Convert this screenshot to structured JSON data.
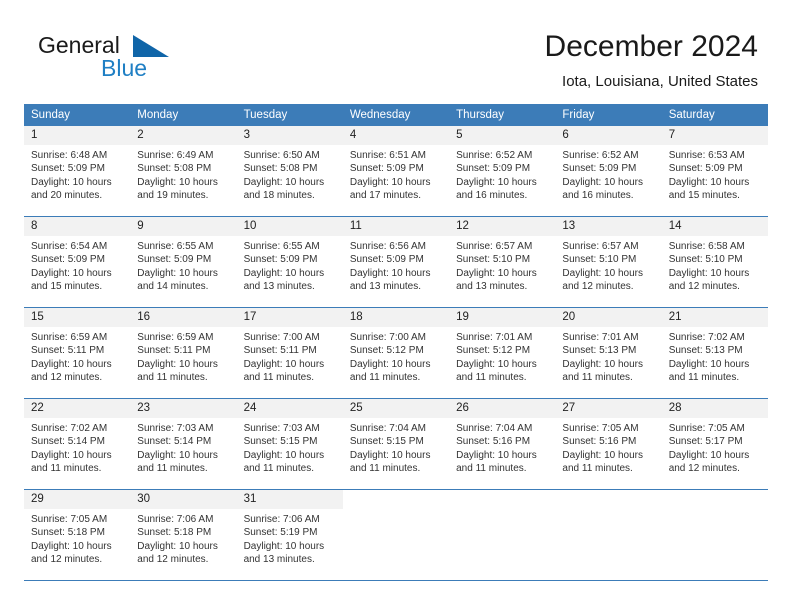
{
  "brand": {
    "name_part1": "General",
    "name_part2": "Blue",
    "triangle_color": "#1065a8",
    "blue_color": "#1f7fc4"
  },
  "header": {
    "title": "December 2024",
    "subtitle": "Iota, Louisiana, United States"
  },
  "calendar": {
    "header_bg": "#3c7cb8",
    "daynum_bg": "#f2f2f2",
    "weekdays": [
      "Sunday",
      "Monday",
      "Tuesday",
      "Wednesday",
      "Thursday",
      "Friday",
      "Saturday"
    ],
    "weeks": [
      [
        {
          "day": "1",
          "sunrise": "Sunrise: 6:48 AM",
          "sunset": "Sunset: 5:09 PM",
          "daylight1": "Daylight: 10 hours",
          "daylight2": "and 20 minutes."
        },
        {
          "day": "2",
          "sunrise": "Sunrise: 6:49 AM",
          "sunset": "Sunset: 5:08 PM",
          "daylight1": "Daylight: 10 hours",
          "daylight2": "and 19 minutes."
        },
        {
          "day": "3",
          "sunrise": "Sunrise: 6:50 AM",
          "sunset": "Sunset: 5:08 PM",
          "daylight1": "Daylight: 10 hours",
          "daylight2": "and 18 minutes."
        },
        {
          "day": "4",
          "sunrise": "Sunrise: 6:51 AM",
          "sunset": "Sunset: 5:09 PM",
          "daylight1": "Daylight: 10 hours",
          "daylight2": "and 17 minutes."
        },
        {
          "day": "5",
          "sunrise": "Sunrise: 6:52 AM",
          "sunset": "Sunset: 5:09 PM",
          "daylight1": "Daylight: 10 hours",
          "daylight2": "and 16 minutes."
        },
        {
          "day": "6",
          "sunrise": "Sunrise: 6:52 AM",
          "sunset": "Sunset: 5:09 PM",
          "daylight1": "Daylight: 10 hours",
          "daylight2": "and 16 minutes."
        },
        {
          "day": "7",
          "sunrise": "Sunrise: 6:53 AM",
          "sunset": "Sunset: 5:09 PM",
          "daylight1": "Daylight: 10 hours",
          "daylight2": "and 15 minutes."
        }
      ],
      [
        {
          "day": "8",
          "sunrise": "Sunrise: 6:54 AM",
          "sunset": "Sunset: 5:09 PM",
          "daylight1": "Daylight: 10 hours",
          "daylight2": "and 15 minutes."
        },
        {
          "day": "9",
          "sunrise": "Sunrise: 6:55 AM",
          "sunset": "Sunset: 5:09 PM",
          "daylight1": "Daylight: 10 hours",
          "daylight2": "and 14 minutes."
        },
        {
          "day": "10",
          "sunrise": "Sunrise: 6:55 AM",
          "sunset": "Sunset: 5:09 PM",
          "daylight1": "Daylight: 10 hours",
          "daylight2": "and 13 minutes."
        },
        {
          "day": "11",
          "sunrise": "Sunrise: 6:56 AM",
          "sunset": "Sunset: 5:09 PM",
          "daylight1": "Daylight: 10 hours",
          "daylight2": "and 13 minutes."
        },
        {
          "day": "12",
          "sunrise": "Sunrise: 6:57 AM",
          "sunset": "Sunset: 5:10 PM",
          "daylight1": "Daylight: 10 hours",
          "daylight2": "and 13 minutes."
        },
        {
          "day": "13",
          "sunrise": "Sunrise: 6:57 AM",
          "sunset": "Sunset: 5:10 PM",
          "daylight1": "Daylight: 10 hours",
          "daylight2": "and 12 minutes."
        },
        {
          "day": "14",
          "sunrise": "Sunrise: 6:58 AM",
          "sunset": "Sunset: 5:10 PM",
          "daylight1": "Daylight: 10 hours",
          "daylight2": "and 12 minutes."
        }
      ],
      [
        {
          "day": "15",
          "sunrise": "Sunrise: 6:59 AM",
          "sunset": "Sunset: 5:11 PM",
          "daylight1": "Daylight: 10 hours",
          "daylight2": "and 12 minutes."
        },
        {
          "day": "16",
          "sunrise": "Sunrise: 6:59 AM",
          "sunset": "Sunset: 5:11 PM",
          "daylight1": "Daylight: 10 hours",
          "daylight2": "and 11 minutes."
        },
        {
          "day": "17",
          "sunrise": "Sunrise: 7:00 AM",
          "sunset": "Sunset: 5:11 PM",
          "daylight1": "Daylight: 10 hours",
          "daylight2": "and 11 minutes."
        },
        {
          "day": "18",
          "sunrise": "Sunrise: 7:00 AM",
          "sunset": "Sunset: 5:12 PM",
          "daylight1": "Daylight: 10 hours",
          "daylight2": "and 11 minutes."
        },
        {
          "day": "19",
          "sunrise": "Sunrise: 7:01 AM",
          "sunset": "Sunset: 5:12 PM",
          "daylight1": "Daylight: 10 hours",
          "daylight2": "and 11 minutes."
        },
        {
          "day": "20",
          "sunrise": "Sunrise: 7:01 AM",
          "sunset": "Sunset: 5:13 PM",
          "daylight1": "Daylight: 10 hours",
          "daylight2": "and 11 minutes."
        },
        {
          "day": "21",
          "sunrise": "Sunrise: 7:02 AM",
          "sunset": "Sunset: 5:13 PM",
          "daylight1": "Daylight: 10 hours",
          "daylight2": "and 11 minutes."
        }
      ],
      [
        {
          "day": "22",
          "sunrise": "Sunrise: 7:02 AM",
          "sunset": "Sunset: 5:14 PM",
          "daylight1": "Daylight: 10 hours",
          "daylight2": "and 11 minutes."
        },
        {
          "day": "23",
          "sunrise": "Sunrise: 7:03 AM",
          "sunset": "Sunset: 5:14 PM",
          "daylight1": "Daylight: 10 hours",
          "daylight2": "and 11 minutes."
        },
        {
          "day": "24",
          "sunrise": "Sunrise: 7:03 AM",
          "sunset": "Sunset: 5:15 PM",
          "daylight1": "Daylight: 10 hours",
          "daylight2": "and 11 minutes."
        },
        {
          "day": "25",
          "sunrise": "Sunrise: 7:04 AM",
          "sunset": "Sunset: 5:15 PM",
          "daylight1": "Daylight: 10 hours",
          "daylight2": "and 11 minutes."
        },
        {
          "day": "26",
          "sunrise": "Sunrise: 7:04 AM",
          "sunset": "Sunset: 5:16 PM",
          "daylight1": "Daylight: 10 hours",
          "daylight2": "and 11 minutes."
        },
        {
          "day": "27",
          "sunrise": "Sunrise: 7:05 AM",
          "sunset": "Sunset: 5:16 PM",
          "daylight1": "Daylight: 10 hours",
          "daylight2": "and 11 minutes."
        },
        {
          "day": "28",
          "sunrise": "Sunrise: 7:05 AM",
          "sunset": "Sunset: 5:17 PM",
          "daylight1": "Daylight: 10 hours",
          "daylight2": "and 12 minutes."
        }
      ],
      [
        {
          "day": "29",
          "sunrise": "Sunrise: 7:05 AM",
          "sunset": "Sunset: 5:18 PM",
          "daylight1": "Daylight: 10 hours",
          "daylight2": "and 12 minutes."
        },
        {
          "day": "30",
          "sunrise": "Sunrise: 7:06 AM",
          "sunset": "Sunset: 5:18 PM",
          "daylight1": "Daylight: 10 hours",
          "daylight2": "and 12 minutes."
        },
        {
          "day": "31",
          "sunrise": "Sunrise: 7:06 AM",
          "sunset": "Sunset: 5:19 PM",
          "daylight1": "Daylight: 10 hours",
          "daylight2": "and 13 minutes."
        },
        {
          "day": "",
          "sunrise": "",
          "sunset": "",
          "daylight1": "",
          "daylight2": ""
        },
        {
          "day": "",
          "sunrise": "",
          "sunset": "",
          "daylight1": "",
          "daylight2": ""
        },
        {
          "day": "",
          "sunrise": "",
          "sunset": "",
          "daylight1": "",
          "daylight2": ""
        },
        {
          "day": "",
          "sunrise": "",
          "sunset": "",
          "daylight1": "",
          "daylight2": ""
        }
      ]
    ]
  }
}
